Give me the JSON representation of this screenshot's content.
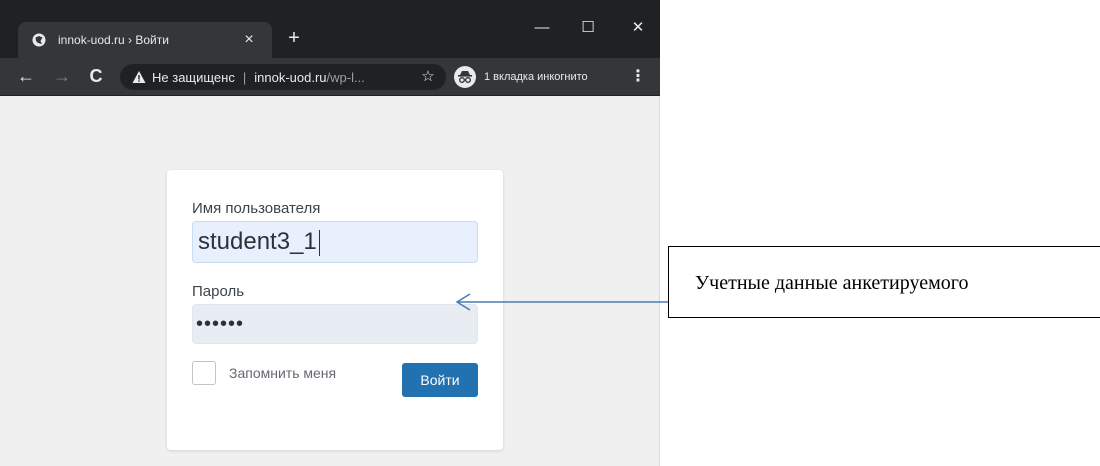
{
  "browser": {
    "tab_title": "innok-uod.ru › Войти",
    "tab_close": "×",
    "new_tab": "+",
    "window_buttons": {
      "minimize": "—",
      "maximize": "☐",
      "close": "✕"
    },
    "nav": {
      "back": "←",
      "forward": "→",
      "reload": "C"
    },
    "address_bar": {
      "security_text": "Не защищенс",
      "url_host": "innok-uod.ru",
      "url_path": "/wp-l..."
    },
    "bookmark_star": "☆",
    "incognito_label": "1 вкладка инкогнито",
    "menu": "⋮"
  },
  "login_form": {
    "username_label": "Имя пользователя",
    "username_value": "student3_1",
    "password_label": "Пароль",
    "password_value": "••••••",
    "remember_label": "Запомнить меня",
    "submit_label": "Войти"
  },
  "annotation": {
    "text": "Учетные данные анкетируемого"
  },
  "colors": {
    "chrome_dark": "#202124",
    "chrome_toolbar": "#35363a",
    "page_bg": "#f0f0f1",
    "button_blue": "#2271b1",
    "input_fill": "#e8f0fe",
    "arrow": "#4a7ab5"
  }
}
